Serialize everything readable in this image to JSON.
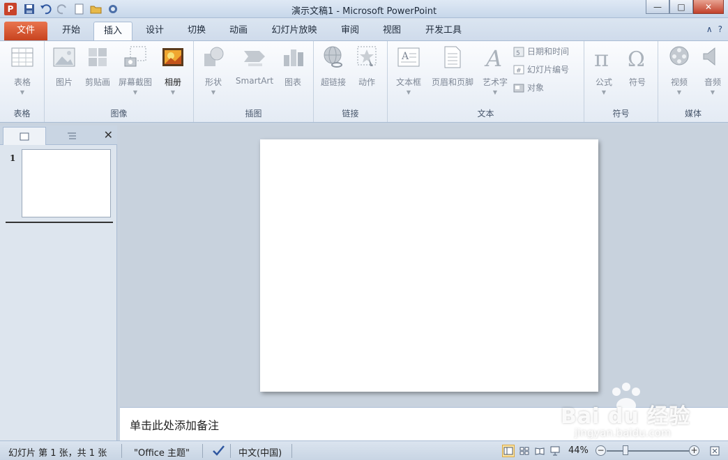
{
  "window": {
    "title": "演示文稿1 - Microsoft PowerPoint",
    "app_icon_letter": "P",
    "minimize": "—",
    "maximize": "□",
    "close": "✕"
  },
  "tabs": [
    {
      "label": "文件",
      "kind": "file"
    },
    {
      "label": "开始"
    },
    {
      "label": "插入",
      "active": true
    },
    {
      "label": "设计"
    },
    {
      "label": "切换"
    },
    {
      "label": "动画"
    },
    {
      "label": "幻灯片放映"
    },
    {
      "label": "审阅"
    },
    {
      "label": "视图"
    },
    {
      "label": "开发工具"
    }
  ],
  "ribbon": {
    "groups": {
      "tables": {
        "label": "表格",
        "table_btn": "表格"
      },
      "images": {
        "label": "图像",
        "picture": "图片",
        "clipart": "剪贴画",
        "screenshot": "屏幕截图",
        "album": "相册"
      },
      "illustrations": {
        "label": "插图",
        "shapes": "形状",
        "smartart": "SmartArt",
        "chart": "图表"
      },
      "links": {
        "label": "链接",
        "hyperlink": "超链接",
        "action": "动作"
      },
      "text": {
        "label": "文本",
        "textbox": "文本框",
        "header_footer": "页眉和页脚",
        "wordart": "艺术字",
        "datetime": "日期和时间",
        "slide_number": "幻灯片编号",
        "object": "对象"
      },
      "symbols": {
        "label": "符号",
        "equation": "公式",
        "symbol": "符号"
      },
      "media": {
        "label": "媒体",
        "video": "视频",
        "audio": "音频"
      }
    }
  },
  "left_pane": {
    "slide_number": "1",
    "close": "✕"
  },
  "notes": {
    "placeholder": "单击此处添加备注"
  },
  "watermark": {
    "main": "Bai du 经验",
    "sub": "jingyan.baidu.com"
  },
  "status": {
    "slide_info": "幻灯片 第 1 张，共 1 张",
    "theme": "\"Office 主题\"",
    "language": "中文(中国)",
    "zoom": "44%",
    "zoom_minus": "−",
    "zoom_plus": "+"
  },
  "colors": {
    "file_tab": "#d6512a",
    "ribbon_bg": "#f3f6fa",
    "status_bg": "#d2dcea"
  }
}
